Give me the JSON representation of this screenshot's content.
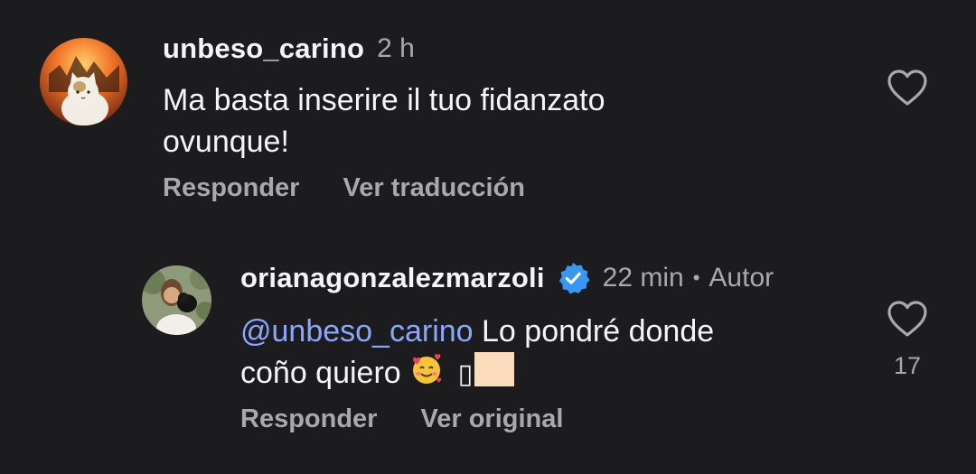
{
  "comments": [
    {
      "username": "unbeso_carino",
      "time": "2 h",
      "text_line1": "Ma basta inserire il tuo fidanzato",
      "text_line2": "ovunque!",
      "actions": {
        "reply": "Responder",
        "translate": "Ver traducción"
      },
      "like_icon": "heart-outline-icon"
    },
    {
      "username": "orianagonzalezmarzoli",
      "verified_icon": "verified-badge-icon",
      "time": "22 min",
      "separator": "•",
      "author_label": "Autor",
      "mention": "@unbeso_carino",
      "text_line1_rest": " Lo pondré donde",
      "text_line2": "coño quiero ",
      "emoji_1": "🥰",
      "emoji_2": "▯",
      "actions": {
        "reply": "Responder",
        "original": "Ver original"
      },
      "like_icon": "heart-outline-icon",
      "like_count": "17"
    }
  ],
  "colors": {
    "background": "#1c1c1f",
    "text": "#f5f5f5",
    "secondary_text": "#a8a8ad",
    "mention": "#8aa6ff",
    "verified": "#3897f0"
  }
}
